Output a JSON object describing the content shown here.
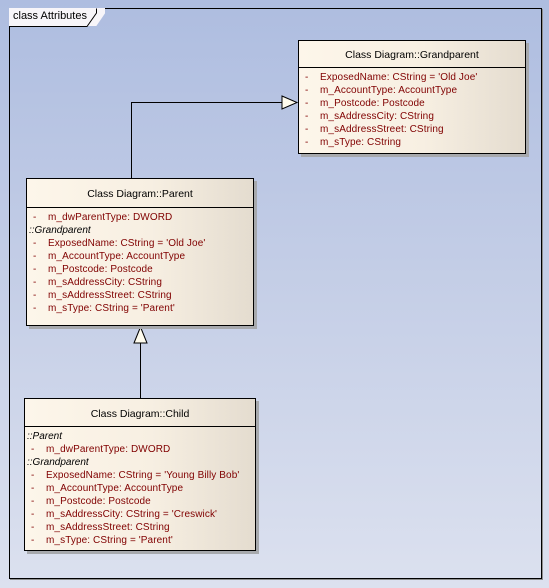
{
  "frame": {
    "label": "class Attributes"
  },
  "classes": {
    "grandparent": {
      "name": "Class Diagram::Grandparent",
      "rows": [
        {
          "kind": "attr",
          "visibility": "-",
          "text": "ExposedName:  CString = 'Old Joe'"
        },
        {
          "kind": "attr",
          "visibility": "-",
          "text": "m_AccountType:  AccountType"
        },
        {
          "kind": "attr",
          "visibility": "-",
          "text": "m_Postcode:  Postcode"
        },
        {
          "kind": "attr",
          "visibility": "-",
          "text": "m_sAddressCity:  CString"
        },
        {
          "kind": "attr",
          "visibility": "-",
          "text": "m_sAddressStreet:  CString"
        },
        {
          "kind": "attr",
          "visibility": "-",
          "text": "m_sType:  CString"
        }
      ]
    },
    "parent": {
      "name": "Class Diagram::Parent",
      "rows": [
        {
          "kind": "attr",
          "visibility": "-",
          "text": "m_dwParentType:  DWORD"
        },
        {
          "kind": "group",
          "text": "::Grandparent"
        },
        {
          "kind": "attr",
          "visibility": "-",
          "text": "ExposedName:  CString = 'Old Joe'"
        },
        {
          "kind": "attr",
          "visibility": "-",
          "text": "m_AccountType:  AccountType"
        },
        {
          "kind": "attr",
          "visibility": "-",
          "text": "m_Postcode:  Postcode"
        },
        {
          "kind": "attr",
          "visibility": "-",
          "text": "m_sAddressCity:  CString"
        },
        {
          "kind": "attr",
          "visibility": "-",
          "text": "m_sAddressStreet:  CString"
        },
        {
          "kind": "attr",
          "visibility": "-",
          "text": "m_sType:  CString = 'Parent'"
        }
      ]
    },
    "child": {
      "name": "Class Diagram::Child",
      "rows": [
        {
          "kind": "group",
          "text": "::Parent"
        },
        {
          "kind": "attr",
          "visibility": "-",
          "text": "m_dwParentType:  DWORD"
        },
        {
          "kind": "group",
          "text": "::Grandparent"
        },
        {
          "kind": "attr",
          "visibility": "-",
          "text": "ExposedName:  CString = 'Young Billy Bob'"
        },
        {
          "kind": "attr",
          "visibility": "-",
          "text": "m_AccountType:  AccountType"
        },
        {
          "kind": "attr",
          "visibility": "-",
          "text": "m_Postcode:  Postcode"
        },
        {
          "kind": "attr",
          "visibility": "-",
          "text": "m_sAddressCity:  CString = 'Creswick'"
        },
        {
          "kind": "attr",
          "visibility": "-",
          "text": "m_sAddressStreet:  CString"
        },
        {
          "kind": "attr",
          "visibility": "-",
          "text": "m_sType:  CString = 'Parent'"
        }
      ]
    }
  },
  "relationships": [
    {
      "type": "generalization",
      "from": "parent",
      "to": "grandparent"
    },
    {
      "type": "generalization",
      "from": "child",
      "to": "parent"
    }
  ],
  "colors": {
    "attribute_text": "#800000",
    "group_text": "#000000",
    "background_top": "#aebde0",
    "background_bottom": "#dce1ef"
  }
}
